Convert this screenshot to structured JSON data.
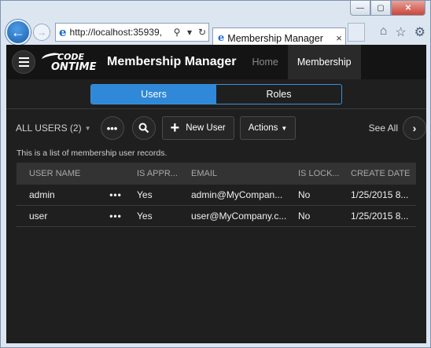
{
  "browser": {
    "address": "http://localhost:35939,",
    "tab_title": "Membership Manager",
    "controls": {
      "minimize": "—",
      "maximize": "▢",
      "close": "✕"
    }
  },
  "app": {
    "title": "Membership Manager",
    "logo_line1": "CODE",
    "logo_line2": "ONTIME",
    "nav": {
      "home": "Home",
      "membership": "Membership"
    }
  },
  "segments": {
    "users": "Users",
    "roles": "Roles"
  },
  "toolbar": {
    "view_label": "ALL USERS (2)",
    "more": "•••",
    "new_user": "New User",
    "actions": "Actions",
    "see_all": "See All"
  },
  "description": "This is a list of membership user records.",
  "grid": {
    "columns": [
      "USER NAME",
      "IS APPR...",
      "EMAIL",
      "IS LOCK...",
      "CREATE DATE"
    ],
    "rows": [
      {
        "user": "admin",
        "dots": "•••",
        "approved": "Yes",
        "email": "admin@MyCompan...",
        "locked": "No",
        "created": "1/25/2015 8..."
      },
      {
        "user": "user",
        "dots": "•••",
        "approved": "Yes",
        "email": "user@MyCompany.c...",
        "locked": "No",
        "created": "1/25/2015 8..."
      }
    ]
  },
  "icons": {
    "back": "back-arrow-icon",
    "forward": "forward-arrow-icon",
    "search": "search-icon",
    "refresh": "refresh-icon",
    "home": "home-icon",
    "favorites": "star-icon",
    "settings": "gear-icon"
  },
  "colors": {
    "accent": "#2f88d8",
    "page_bg": "#1f1f1f",
    "topbar": "#141414"
  }
}
